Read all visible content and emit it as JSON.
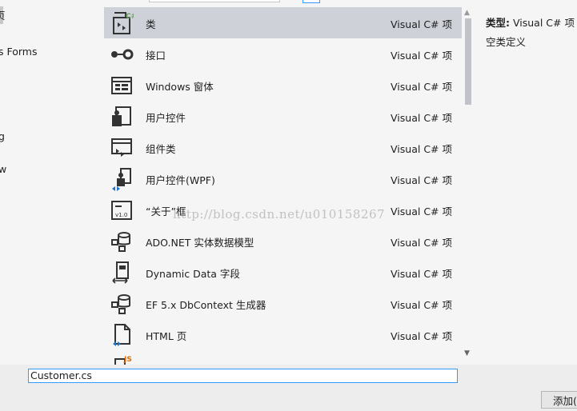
{
  "left_panel": {
    "items": [
      {
        "label": "页"
      },
      {
        "label": "s Forms"
      },
      {
        "label": "g"
      },
      {
        "label": "w"
      }
    ]
  },
  "templates": [
    {
      "name": "类",
      "type": "Visual C# 项",
      "icon": "class-icon",
      "selected": true
    },
    {
      "name": "接口",
      "type": "Visual C# 项",
      "icon": "interface-icon"
    },
    {
      "name": "Windows 窗体",
      "type": "Visual C# 项",
      "icon": "windows-form-icon"
    },
    {
      "name": "用户控件",
      "type": "Visual C# 项",
      "icon": "user-control-icon"
    },
    {
      "name": "组件类",
      "type": "Visual C# 项",
      "icon": "component-class-icon"
    },
    {
      "name": "用户控件(WPF)",
      "type": "Visual C# 项",
      "icon": "wpf-user-control-icon"
    },
    {
      "name": "“关于”框",
      "type": "Visual C# 项",
      "icon": "about-box-icon"
    },
    {
      "name": "ADO.NET 实体数据模型",
      "type": "Visual C# 项",
      "icon": "entity-data-model-icon"
    },
    {
      "name": "Dynamic Data 字段",
      "type": "Visual C# 项",
      "icon": "dynamic-data-field-icon"
    },
    {
      "name": "EF 5.x DbContext 生成器",
      "type": "Visual C# 项",
      "icon": "dbcontext-generator-icon"
    },
    {
      "name": "HTML 页",
      "type": "Visual C# 项",
      "icon": "html-page-icon"
    },
    {
      "name": "",
      "type": "",
      "icon": "javascript-file-icon"
    }
  ],
  "details": {
    "type_label": "类型:",
    "type_value": "Visual C# 项",
    "description": "空类定义"
  },
  "watermark": "http://blog.csdn.net/u010158267",
  "name_field": {
    "value": "Customer.cs"
  },
  "add_button": {
    "label": "添加(A)"
  },
  "colors": {
    "selection": "#cfd1d9",
    "accent": "#3399ff",
    "csharp_green": "#68a063"
  }
}
